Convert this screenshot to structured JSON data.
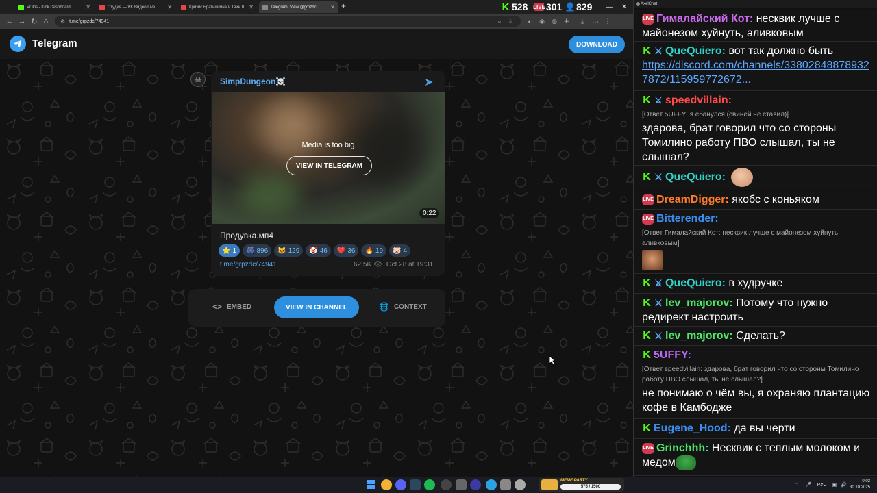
{
  "browser": {
    "tabs": [
      {
        "title": "VODs - Kick Dashboard",
        "favicon_color": "#53fc18"
      },
      {
        "title": "Студия — VK Видео Live",
        "favicon_color": "#e64646"
      },
      {
        "title": "Кризис Братишкина // Твич Л",
        "favicon_color": "#e64646"
      },
      {
        "title": "Telegram: View @grpzdc",
        "favicon_color": "#888888"
      }
    ],
    "url": "t.me/grpzdc/74941",
    "stats": {
      "kick": "528",
      "vk": "301",
      "viewers": "829"
    }
  },
  "telegram": {
    "brand": "Telegram",
    "download_label": "DOWNLOAD",
    "post": {
      "channel": "SimpDungeon☠️",
      "media_message": "Media is too big",
      "media_button": "VIEW IN TELEGRAM",
      "duration": "0:22",
      "caption": "Продувка.мп4",
      "reactions": [
        {
          "emoji": "⭐",
          "count": "1"
        },
        {
          "emoji": "🎆",
          "count": "896"
        },
        {
          "emoji": "😺",
          "count": "129"
        },
        {
          "emoji": "🤡",
          "count": "46"
        },
        {
          "emoji": "❤️",
          "count": "36"
        },
        {
          "emoji": "🔥",
          "count": "19"
        },
        {
          "emoji": "🐷",
          "count": "4"
        }
      ],
      "link": "t.me/grpzdc/74941",
      "views": "62.5K",
      "date": "Oct 28 at 19:31"
    },
    "actions": {
      "embed": "EMBED",
      "view_channel": "VIEW IN CHANNEL",
      "context": "CONTEXT"
    }
  },
  "chat": {
    "app_title": "AxelChat",
    "messages": [
      {
        "user": "Гималайский Кот:",
        "color": "#c96ae8",
        "badges": [
          "live"
        ],
        "text": "несквик лучше с майонезом хуйнуть, аливковым"
      },
      {
        "user": "QueQuiero:",
        "color": "#2fd3c8",
        "badges": [
          "kick",
          "sword"
        ],
        "text": "вот так должно быть",
        "link": "https://discord.com/channels/338028488789327872/115959772672..."
      },
      {
        "user": "speedvillain:",
        "color": "#ff4a4a",
        "badges": [
          "kick",
          "sword"
        ],
        "reply": "[Ответ 5UFFY: я ебанулся (свиней не ставил)]",
        "text": "здарова, брат говорил что со стороны Томилино работу ПВО слышал, ты не слышал?"
      },
      {
        "user": "QueQuiero:",
        "color": "#2fd3c8",
        "badges": [
          "kick",
          "sword"
        ],
        "text": "",
        "emote": "bald-face-emote"
      },
      {
        "user": "DreamDigger:",
        "color": "#ff7a2a",
        "badges": [
          "live"
        ],
        "text": "якобс с коньяком"
      },
      {
        "user": "Bitterender:",
        "color": "#3a8ef0",
        "badges": [
          "live"
        ],
        "reply": "[Ответ Гималайский Кот: несквик лучше с майонезом хуйнуть, аливковым]",
        "text": "",
        "emote": "face-emote"
      },
      {
        "user": "QueQuiero:",
        "color": "#2fd3c8",
        "badges": [
          "kick",
          "sword"
        ],
        "text": "в худручке"
      },
      {
        "user": "lev_majorov:",
        "color": "#4ee86a",
        "badges": [
          "kick",
          "sword"
        ],
        "text": "Потому что нужно редирект настроить"
      },
      {
        "user": "lev_majorov:",
        "color": "#4ee86a",
        "badges": [
          "kick",
          "sword"
        ],
        "text": "Сделать?"
      },
      {
        "user": "5UFFY:",
        "color": "#b86af0",
        "badges": [
          "kick"
        ],
        "reply": "[Ответ speedvillain: здарова, брат говорил что со стороны Томилино работу ПВО слышал, ты не слышал?]",
        "text": "не понимаю о чём вы, я охраняю плантацию кофе в Камбодже"
      },
      {
        "user": "Eugene_Hood:",
        "color": "#3a8ef0",
        "badges": [
          "kick"
        ],
        "text": "да вы черти"
      },
      {
        "user": "Grinchhh:",
        "color": "#4ee86a",
        "badges": [
          "live"
        ],
        "text": "Несквик с теплым молоком и медом",
        "emote": "pepe-emote"
      }
    ]
  },
  "taskbar": {
    "meme_title": "MEME PARTY",
    "meme_progress": "575 / 1500",
    "lang": "РУС",
    "time": "0:02",
    "date": "30.10.2025"
  }
}
